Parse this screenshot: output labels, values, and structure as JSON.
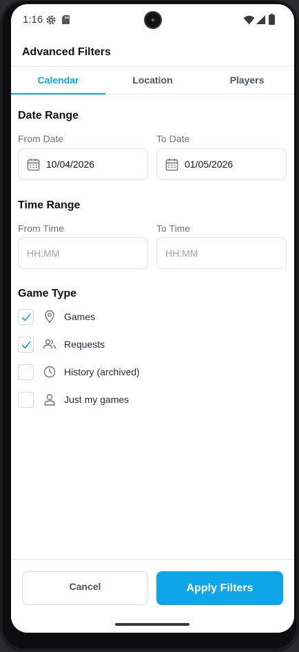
{
  "status_bar": {
    "time": "1:16",
    "icons": [
      "gear-icon",
      "sd-card-icon",
      "wifi-icon",
      "signal-icon",
      "battery-icon"
    ]
  },
  "header": {
    "title": "Advanced Filters"
  },
  "tabs": [
    {
      "label": "Calendar",
      "active": true
    },
    {
      "label": "Location",
      "active": false
    },
    {
      "label": "Players",
      "active": false
    }
  ],
  "date_range": {
    "title": "Date Range",
    "from_label": "From Date",
    "from_value": "10/04/2026",
    "to_label": "To Date",
    "to_value": "01/05/2026"
  },
  "time_range": {
    "title": "Time Range",
    "from_label": "From Time",
    "from_placeholder": "HH:MM",
    "to_label": "To Time",
    "to_placeholder": "HH:MM"
  },
  "game_type": {
    "title": "Game Type",
    "options": [
      {
        "label": "Games",
        "checked": true,
        "icon": "location-pin-icon"
      },
      {
        "label": "Requests",
        "checked": true,
        "icon": "users-icon"
      },
      {
        "label": "History (archived)",
        "checked": false,
        "icon": "clock-icon"
      },
      {
        "label": "Just my games",
        "checked": false,
        "icon": "user-icon"
      }
    ]
  },
  "footer": {
    "cancel_label": "Cancel",
    "apply_label": "Apply Filters"
  },
  "colors": {
    "accent": "#0ea5e9",
    "text_primary": "#111111",
    "text_muted": "#6b7280",
    "border": "#dfe3e8"
  }
}
